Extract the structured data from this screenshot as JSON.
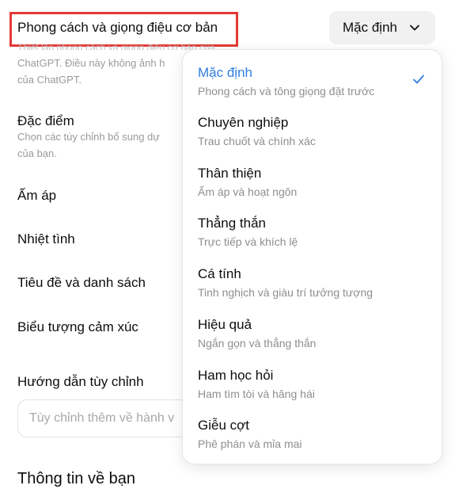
{
  "setting": {
    "title": "Phong cách và giọng điệu cơ bản",
    "description_line1": "Thiết lập phong cách và giọng điệu cơ bản của",
    "description_line2": "ChatGPT. Điều này không ảnh h",
    "description_line3": "của ChatGPT."
  },
  "select": {
    "value": "Mặc định",
    "chevron_icon": "chevron-down-icon"
  },
  "traits": {
    "title": "Đặc điểm",
    "description_line1": "Chọn các tùy chỉnh bổ sung dự",
    "description_line2": "của bạn."
  },
  "options_list": {
    "warm": "Ấm áp",
    "enthusiastic": "Nhiệt tình",
    "headers_lists": "Tiêu đề và danh sách",
    "emoji": "Biểu tượng cảm xúc"
  },
  "custom_instructions": {
    "label": "Hướng dẫn tùy chỉnh",
    "placeholder": "Tùy chỉnh thêm về hành v"
  },
  "about_you": {
    "title": "Thông tin về bạn"
  },
  "menu": {
    "items": [
      {
        "label": "Mặc định",
        "description": "Phong cách và tông giọng đặt trước",
        "selected": true
      },
      {
        "label": "Chuyên nghiệp",
        "description": "Trau chuốt và chính xác",
        "selected": false
      },
      {
        "label": "Thân thiện",
        "description": "Ấm áp và hoạt ngôn",
        "selected": false
      },
      {
        "label": "Thẳng thắn",
        "description": "Trực tiếp và khích lệ",
        "selected": false
      },
      {
        "label": "Cá tính",
        "description": "Tinh nghịch và giàu trí tưởng tượng",
        "selected": false
      },
      {
        "label": "Hiệu quả",
        "description": "Ngắn gọn và thẳng thắn",
        "selected": false
      },
      {
        "label": "Ham học hỏi",
        "description": "Ham tìm tòi và hăng hái",
        "selected": false
      },
      {
        "label": "Giễu cợt",
        "description": "Phê phán và mỉa mai",
        "selected": false
      }
    ],
    "check_icon": "checkmark-icon"
  },
  "colors": {
    "accent": "#2f7de1",
    "highlight": "#e53935",
    "select_bg": "#f1f1f1",
    "muted_text": "#8e8e8e"
  }
}
